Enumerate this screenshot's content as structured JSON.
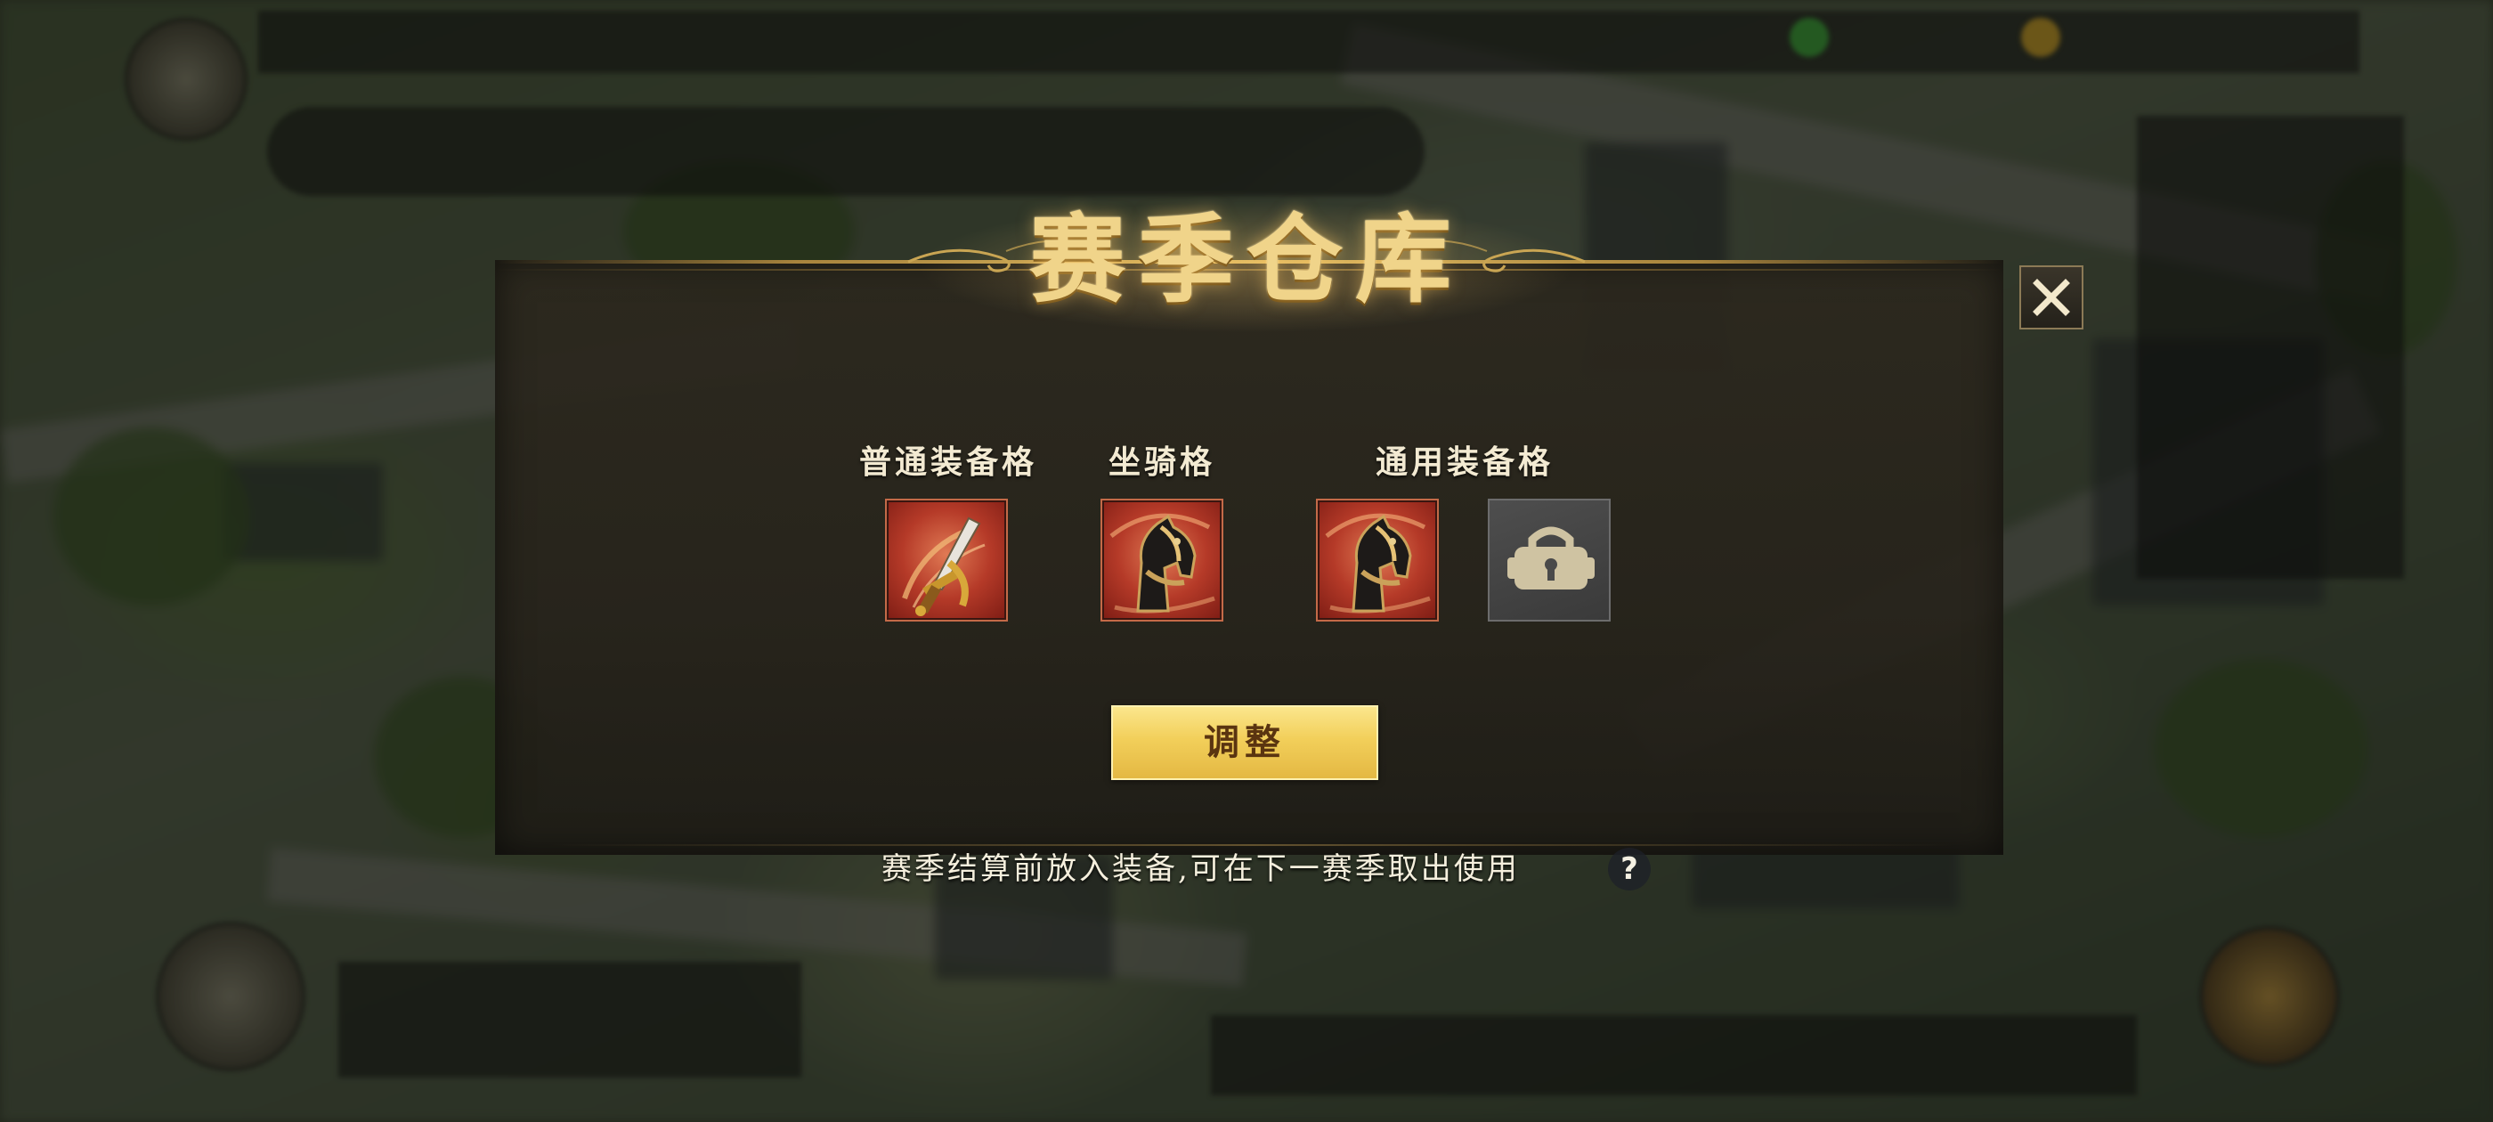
{
  "dialog": {
    "title": "赛季仓库",
    "close_icon": "close-icon",
    "sections": [
      {
        "label": "普通装备格"
      },
      {
        "label": "坐骑格"
      },
      {
        "label": "通用装备格"
      }
    ],
    "slots": [
      {
        "section": "普通装备格",
        "icon": "sword-icon",
        "state": "filled"
      },
      {
        "section": "坐骑格",
        "icon": "horse-icon",
        "state": "filled"
      },
      {
        "section": "通用装备格",
        "icon": "horse-icon",
        "state": "filled"
      },
      {
        "section": "通用装备格",
        "icon": "lock-icon",
        "state": "locked"
      }
    ],
    "adjust_button": "调整",
    "hint": "赛季结算前放入装备,可在下一赛季取出使用",
    "help_label": "?"
  },
  "colors": {
    "title_gold": "#f0d48a",
    "button_gold": "#f2cf5a",
    "slot_red": "#b53a28",
    "slot_locked": "#3a3a3a"
  }
}
